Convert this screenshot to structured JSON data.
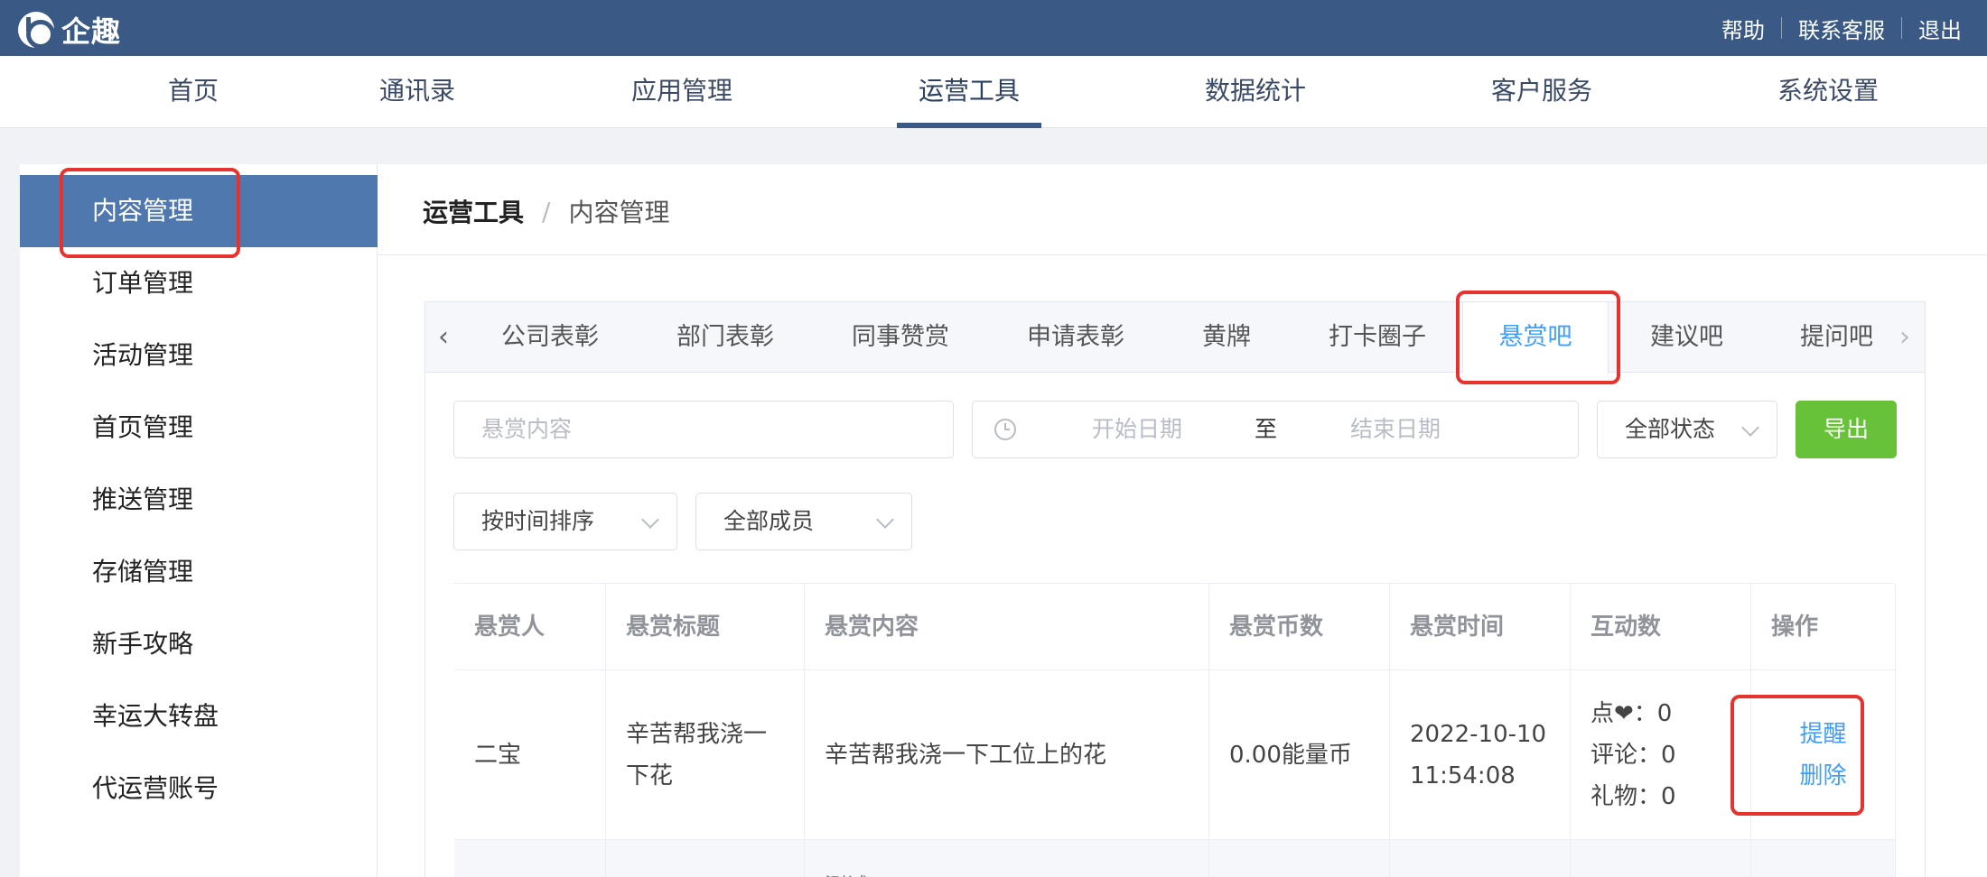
{
  "topbar": {
    "logo_text": "企趣",
    "links": [
      "帮助",
      "联系客服",
      "退出"
    ]
  },
  "nav": {
    "items": [
      "首页",
      "通讯录",
      "应用管理",
      "运营工具",
      "数据统计",
      "客户服务",
      "系统设置"
    ],
    "active": "运营工具"
  },
  "sidebar": {
    "items": [
      "内容管理",
      "订单管理",
      "活动管理",
      "首页管理",
      "推送管理",
      "存储管理",
      "新手攻略",
      "幸运大转盘",
      "代运营账号"
    ],
    "active": "内容管理"
  },
  "breadcrumb": {
    "parent": "运营工具",
    "separator": "/",
    "current": "内容管理"
  },
  "tabs": {
    "items": [
      "公司表彰",
      "部门表彰",
      "同事赞赏",
      "申请表彰",
      "黄牌",
      "打卡圈子",
      "悬赏吧",
      "建议吧",
      "提问吧"
    ],
    "active": "悬赏吧",
    "prev_glyph": "‹",
    "next_glyph": "›"
  },
  "filters": {
    "content_placeholder": "悬赏内容",
    "start_date_placeholder": "开始日期",
    "date_range_separator": "至",
    "end_date_placeholder": "结束日期",
    "status_select": "全部状态",
    "export_button": "导出",
    "sort_select": "按时间排序",
    "member_select": "全部成员"
  },
  "table": {
    "headers": [
      "悬赏人",
      "悬赏标题",
      "悬赏内容",
      "悬赏币数",
      "悬赏时间",
      "互动数",
      "操作"
    ],
    "rows": [
      {
        "person": "二宝",
        "title_line1": "辛苦帮我浇一",
        "title_line2": "下花",
        "content": "辛苦帮我浇一下工位上的花",
        "coins": "0.00能量币",
        "time_date": "2022-10-10",
        "time_clock": "11:54:08",
        "likes": "点❤：0",
        "comments": "评论：0",
        "gifts": "礼物：0",
        "action_remind": "提醒",
        "action_delete": "删除"
      },
      {
        "content_partial": "测试"
      }
    ]
  },
  "colors": {
    "topbar": "#3a5a85",
    "sidebar_active": "#4f78ae",
    "link": "#409eff",
    "export": "#67c23a",
    "highlight": "#e8322e"
  }
}
